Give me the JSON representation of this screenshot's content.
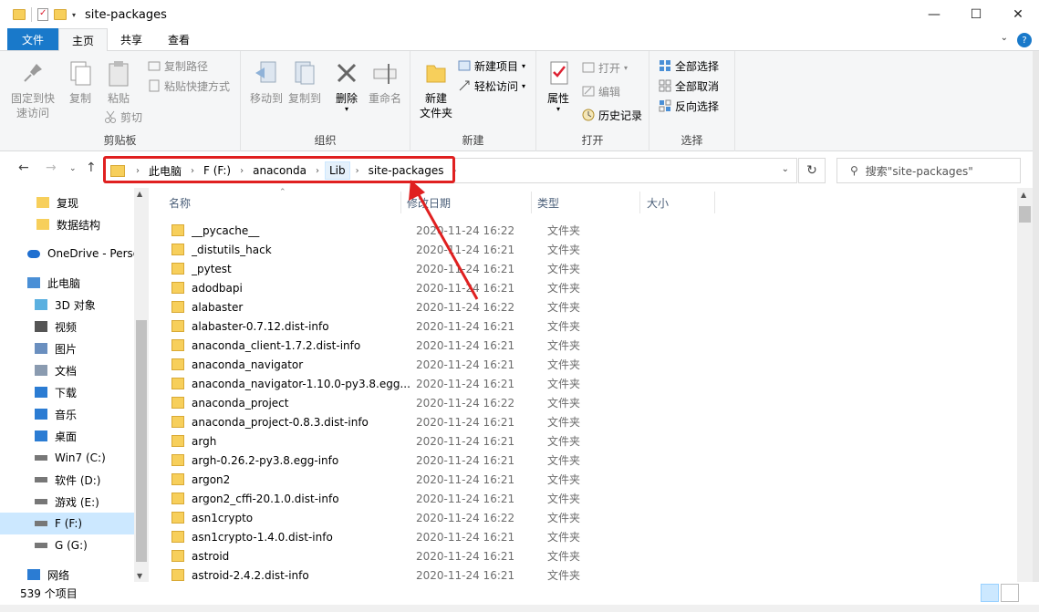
{
  "window": {
    "title": "site-packages",
    "minimize": "—",
    "maximize": "☐",
    "close": "✕"
  },
  "ribbon_tabs": [
    "文件",
    "主页",
    "共享",
    "查看"
  ],
  "ribbon": {
    "clipboard": {
      "pin_label_1": "固定到快",
      "pin_label_2": "速访问",
      "copy": "复制",
      "paste": "粘贴",
      "copy_path": "复制路径",
      "paste_shortcut": "粘贴快捷方式",
      "cut": "剪切",
      "group": "剪贴板"
    },
    "organize": {
      "move_to": "移动到",
      "copy_to": "复制到",
      "delete": "删除",
      "rename": "重命名",
      "group": "组织"
    },
    "new": {
      "new_folder_1": "新建",
      "new_folder_2": "文件夹",
      "new_item": "新建项目",
      "easy_access": "轻松访问",
      "group": "新建"
    },
    "open": {
      "properties": "属性",
      "open": "打开",
      "edit": "编辑",
      "history": "历史记录",
      "group": "打开"
    },
    "select": {
      "select_all": "全部选择",
      "select_none": "全部取消",
      "invert": "反向选择",
      "group": "选择"
    }
  },
  "address": {
    "crumbs": [
      "此电脑",
      "F (F:)",
      "anaconda",
      "Lib",
      "site-packages"
    ],
    "search_placeholder": "搜索\"site-packages\""
  },
  "nav_pane": [
    {
      "label": "复现",
      "icon": "folder-icon"
    },
    {
      "label": "数据结构",
      "icon": "folder-icon"
    },
    {
      "label": "OneDrive - Perso",
      "icon": "onedrive-icon"
    },
    {
      "label": "此电脑",
      "icon": "pc-icon"
    },
    {
      "label": "3D 对象",
      "icon": "3d-objects-icon"
    },
    {
      "label": "视频",
      "icon": "video-icon"
    },
    {
      "label": "图片",
      "icon": "pictures-icon"
    },
    {
      "label": "文档",
      "icon": "documents-icon"
    },
    {
      "label": "下载",
      "icon": "download-icon"
    },
    {
      "label": "音乐",
      "icon": "music-icon"
    },
    {
      "label": "桌面",
      "icon": "desktop-icon"
    },
    {
      "label": "Win7 (C:)",
      "icon": "drive-icon"
    },
    {
      "label": "软件 (D:)",
      "icon": "drive-icon"
    },
    {
      "label": "游戏 (E:)",
      "icon": "drive-icon"
    },
    {
      "label": "F (F:)",
      "icon": "drive-icon"
    },
    {
      "label": "G (G:)",
      "icon": "drive-icon"
    },
    {
      "label": "网络",
      "icon": "network-icon"
    }
  ],
  "columns": {
    "name": "名称",
    "modified": "修改日期",
    "type": "类型",
    "size": "大小"
  },
  "files": [
    {
      "name": "__pycache__",
      "date": "2020-11-24 16:22",
      "type": "文件夹"
    },
    {
      "name": "_distutils_hack",
      "date": "2020-11-24 16:21",
      "type": "文件夹"
    },
    {
      "name": "_pytest",
      "date": "2020-11-24 16:21",
      "type": "文件夹"
    },
    {
      "name": "adodbapi",
      "date": "2020-11-24 16:21",
      "type": "文件夹"
    },
    {
      "name": "alabaster",
      "date": "2020-11-24 16:22",
      "type": "文件夹"
    },
    {
      "name": "alabaster-0.7.12.dist-info",
      "date": "2020-11-24 16:21",
      "type": "文件夹"
    },
    {
      "name": "anaconda_client-1.7.2.dist-info",
      "date": "2020-11-24 16:21",
      "type": "文件夹"
    },
    {
      "name": "anaconda_navigator",
      "date": "2020-11-24 16:21",
      "type": "文件夹"
    },
    {
      "name": "anaconda_navigator-1.10.0-py3.8.egg...",
      "date": "2020-11-24 16:21",
      "type": "文件夹"
    },
    {
      "name": "anaconda_project",
      "date": "2020-11-24 16:22",
      "type": "文件夹"
    },
    {
      "name": "anaconda_project-0.8.3.dist-info",
      "date": "2020-11-24 16:21",
      "type": "文件夹"
    },
    {
      "name": "argh",
      "date": "2020-11-24 16:21",
      "type": "文件夹"
    },
    {
      "name": "argh-0.26.2-py3.8.egg-info",
      "date": "2020-11-24 16:21",
      "type": "文件夹"
    },
    {
      "name": "argon2",
      "date": "2020-11-24 16:21",
      "type": "文件夹"
    },
    {
      "name": "argon2_cffi-20.1.0.dist-info",
      "date": "2020-11-24 16:21",
      "type": "文件夹"
    },
    {
      "name": "asn1crypto",
      "date": "2020-11-24 16:22",
      "type": "文件夹"
    },
    {
      "name": "asn1crypto-1.4.0.dist-info",
      "date": "2020-11-24 16:21",
      "type": "文件夹"
    },
    {
      "name": "astroid",
      "date": "2020-11-24 16:21",
      "type": "文件夹"
    },
    {
      "name": "astroid-2.4.2.dist-info",
      "date": "2020-11-24 16:21",
      "type": "文件夹"
    }
  ],
  "status": {
    "count": "539 个项目"
  },
  "colors": {
    "accent": "#1979ca",
    "annotation": "#e02020",
    "folder": "#f7cf5b"
  }
}
